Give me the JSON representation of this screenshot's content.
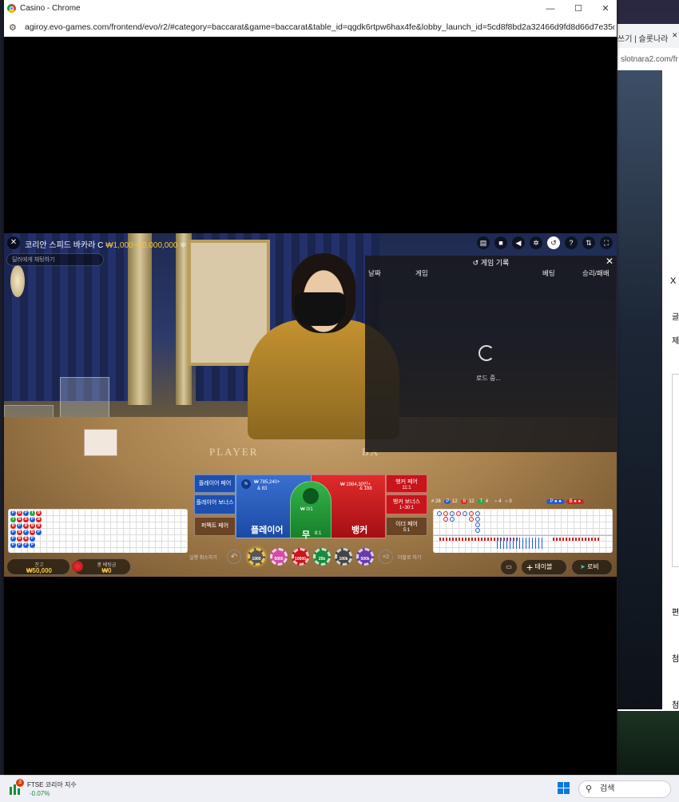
{
  "window": {
    "title": "Casino - Chrome",
    "url": "agiroy.evo-games.com/frontend/evo/r2/#category=baccarat&game=baccarat&table_id=qgdk6rtpw6hax4fe&lobby_launch_id=5cd8f8bd2a32466d9fd8d66d7e35d71f",
    "minimize": "—",
    "maximize": "☐",
    "close": "✕"
  },
  "background_window": {
    "tab_text": "쓰기 | 슬롯나라",
    "tab_close": "✕",
    "url": "slotnara2.com/fr",
    "side_chars": [
      "X",
      "글",
      "제",
      "편",
      "첨",
      "첨"
    ]
  },
  "game": {
    "title": "코리안 스피드 바카라 C",
    "limit": "₩1,000~10,000,000",
    "chat_placeholder": "딜러에게 채팅하기",
    "felt_player": "PLAYER",
    "felt_banker": "BA",
    "top_icons": [
      "chat-icon",
      "camera-icon",
      "sound-icon",
      "settings-icon",
      "history-icon",
      "help-icon",
      "share-icon",
      "fullscreen-icon"
    ]
  },
  "history": {
    "title": "게임 기록",
    "columns": [
      "날짜",
      "게임",
      "베팅",
      "승리/패배"
    ],
    "loading": "로드 중..."
  },
  "bets": {
    "player_pair": "플레이어 페어",
    "player_bonus": "플레이어 보너스",
    "perfect_pair": "퍼펙트 페어",
    "player": "플레이어",
    "player_total": "₩ 785,240+",
    "player_count": "& 83",
    "tie": "무",
    "tie_total": "₩ 0/1",
    "tie_ratio": "8:1",
    "banker": "뱅커",
    "banker_total": "₩ 1984,30만+",
    "banker_count": "& 188",
    "banker_pair": "뱅커 페어",
    "banker_pair_ratio": "11:1",
    "banker_bonus": "뱅커 보너스",
    "banker_bonus_ratio": "1~30:1",
    "either_pair": "이더 페어",
    "either_pair_ratio": "5:1"
  },
  "stats": {
    "round": "# 28",
    "p_label": "P",
    "p_count": "12",
    "b_label": "B",
    "b_count": "12",
    "t_label": "T",
    "t_count": "4",
    "pp_count": "4",
    "bp_count": "0"
  },
  "bead_road": [
    [
      "P",
      "B",
      "P",
      "T",
      "B"
    ],
    [
      "T",
      "B",
      "B",
      "P",
      "B"
    ],
    [
      "B",
      "P",
      "B",
      "B",
      "B"
    ],
    [
      "P",
      "B",
      "P",
      "B",
      "P"
    ],
    [
      "P",
      "B",
      "B",
      "P",
      ""
    ],
    [
      "P",
      "P",
      "P",
      "P",
      ""
    ]
  ],
  "bottom": {
    "balance_label": "잔고",
    "balance": "₩50,000",
    "total_bet_label": "총 베팅금",
    "total_bet": "₩0",
    "undo_label": "실행 취소하기",
    "double_label": "더블로 하기",
    "double_symbol": "×2",
    "chips": [
      "1000",
      "5000",
      "10000",
      "25k",
      "100k",
      "500k"
    ],
    "tables_label": "테이블",
    "lobby_label": "로비"
  },
  "taskbar": {
    "stock_name": "FTSE 코리아 지수",
    "stock_change": "-0.07%",
    "notification_count": "3",
    "search_label": "검색"
  },
  "colors": {
    "player_blue": "#1e5bd8",
    "banker_red": "#d8201e",
    "tie_green": "#28a745",
    "limit_gold": "#f5c542"
  }
}
